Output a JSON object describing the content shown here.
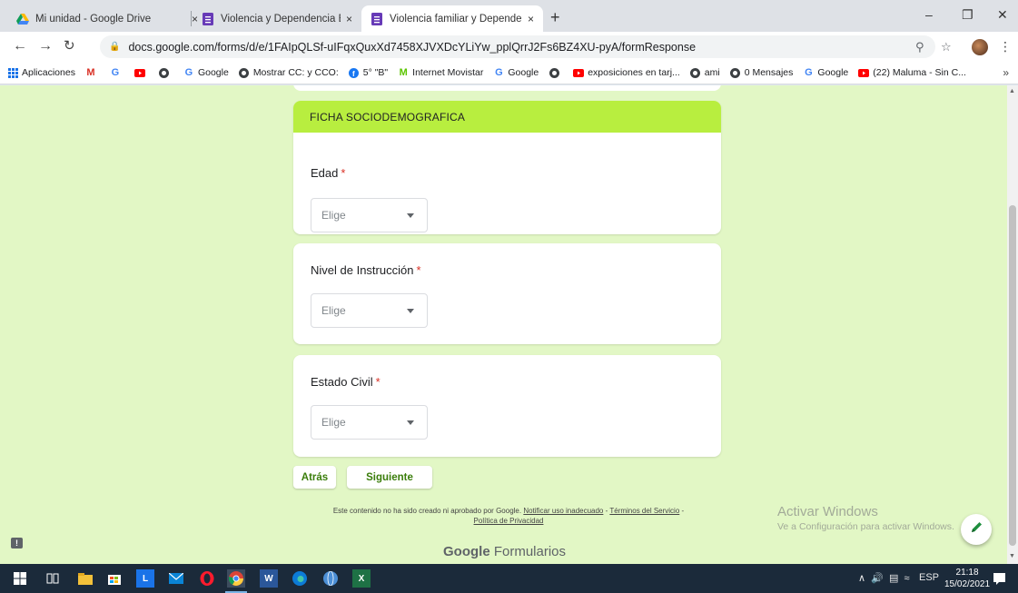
{
  "browser": {
    "tabs": [
      {
        "title": "Mi unidad - Google Drive",
        "icon": "google-drive-icon",
        "active": false
      },
      {
        "title": "Violencia y Dependencia Emocio",
        "icon": "google-forms-icon",
        "active": false
      },
      {
        "title": "Violencia familiar y Dependencia",
        "icon": "google-forms-icon",
        "active": true
      }
    ],
    "tab_close": "×",
    "new_tab": "+",
    "url": "docs.google.com/forms/d/e/1FAIpQLSf-uIFqxQuxXd7458XJVXDcYLiYw_pplQrrJ2Fs6BZ4XU-pyA/formResponse",
    "bookmarks": [
      {
        "label": "Aplicaciones",
        "icon": "apps-grid-icon"
      },
      {
        "label": "",
        "icon": "gmail-icon"
      },
      {
        "label": "",
        "icon": "google-icon"
      },
      {
        "label": "",
        "icon": "youtube-icon"
      },
      {
        "label": "",
        "icon": "globe-icon"
      },
      {
        "label": "Google",
        "icon": "google-icon"
      },
      {
        "label": "Mostrar CC: y CCO:",
        "icon": "globe-icon"
      },
      {
        "label": "5° \"B\"",
        "icon": "facebook-icon"
      },
      {
        "label": "Internet Movistar",
        "icon": "movistar-icon"
      },
      {
        "label": "Google",
        "icon": "google-icon"
      },
      {
        "label": "",
        "icon": "globe-icon"
      },
      {
        "label": "exposiciones en tarj...",
        "icon": "youtube-icon"
      },
      {
        "label": "ami",
        "icon": "globe-icon"
      },
      {
        "label": "0 Mensajes",
        "icon": "globe-icon"
      },
      {
        "label": "Google",
        "icon": "google-icon"
      },
      {
        "label": "(22) Maluma - Sin C...",
        "icon": "youtube-icon"
      }
    ],
    "bookmarks_more": "»"
  },
  "form": {
    "section_title": "FICHA SOCIODEMOGRAFICA",
    "questions": [
      {
        "label": "Edad",
        "required_mark": "*",
        "placeholder": "Elige"
      },
      {
        "label": "Nivel de Instrucción",
        "required_mark": "*",
        "placeholder": "Elige"
      },
      {
        "label": "Estado Civil",
        "required_mark": "*",
        "placeholder": "Elige"
      }
    ],
    "back_label": "Atrás",
    "next_label": "Siguiente",
    "disclaimer_text": "Este contenido no ha sido creado ni aprobado por Google.",
    "report_link": "Notificar uso inadecuado",
    "terms_link": "Términos del Servicio",
    "privacy_link": "Política de Privacidad",
    "brand_google": "Google",
    "brand_forms": "Formularios"
  },
  "watermark": {
    "line1": "Activar Windows",
    "line2": "Ve a Configuración para activar Windows."
  },
  "taskbar": {
    "lang": "ESP",
    "time": "21:18",
    "date": "15/02/2021"
  },
  "colors": {
    "page_bg": "#e2f7c5",
    "section_header": "#b8ee3f",
    "button_text": "#3a7d0a",
    "required": "#d93025"
  }
}
